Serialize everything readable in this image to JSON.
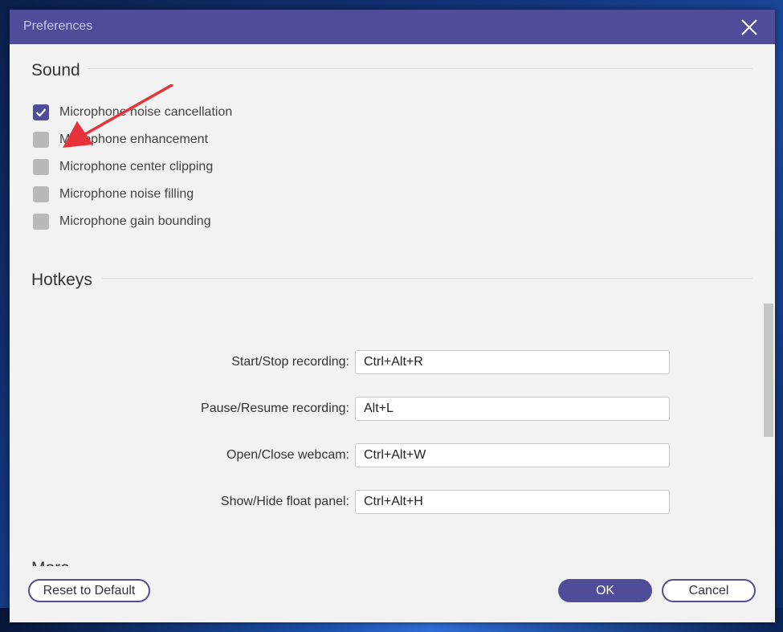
{
  "window": {
    "title": "Preferences"
  },
  "sound": {
    "heading": "Sound",
    "options": [
      {
        "label": "Microphone noise cancellation",
        "checked": true
      },
      {
        "label": "Microphone enhancement",
        "checked": false
      },
      {
        "label": "Microphone center clipping",
        "checked": false
      },
      {
        "label": "Microphone noise filling",
        "checked": false
      },
      {
        "label": "Microphone gain bounding",
        "checked": false
      }
    ]
  },
  "hotkeys": {
    "heading": "Hotkeys",
    "items": [
      {
        "label": "Start/Stop recording:",
        "value": "Ctrl+Alt+R"
      },
      {
        "label": "Pause/Resume recording:",
        "value": "Alt+L"
      },
      {
        "label": "Open/Close webcam:",
        "value": "Ctrl+Alt+W"
      },
      {
        "label": "Show/Hide float panel:",
        "value": "Ctrl+Alt+H"
      }
    ]
  },
  "more": {
    "heading": "More"
  },
  "footer": {
    "reset_label": "Reset to Default",
    "ok_label": "OK",
    "cancel_label": "Cancel"
  },
  "colors": {
    "accent": "#4f4c9a",
    "checkbox_unchecked": "#b9b9b9",
    "annotation_arrow": "#e8323a"
  },
  "icons": {
    "close": "close-icon",
    "check": "checkmark-icon",
    "annotation": "red-arrow-annotation"
  }
}
